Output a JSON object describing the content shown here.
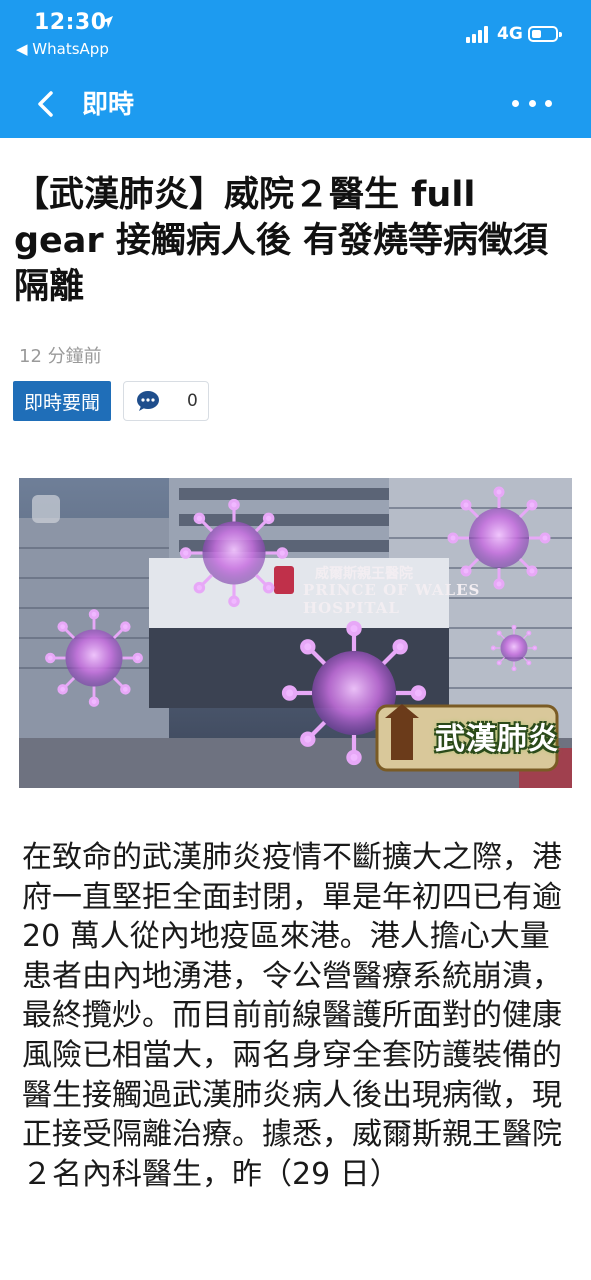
{
  "status_bar": {
    "time": "12:30",
    "back_app": "◀ WhatsApp",
    "network": "4G"
  },
  "nav": {
    "title": "即時",
    "back_icon": "chevron-left-icon",
    "more_icon": "more-dots-icon"
  },
  "article": {
    "headline": "【武漢肺炎】威院２醫生 full gear 接觸病人後 有發燒等病徵須隔離",
    "timestamp": "12 分鐘前",
    "category": "即時要聞",
    "comment_count": "0",
    "image": {
      "sign_en": "PRINCE OF WALES HOSPITAL",
      "sign_cn": "威爾斯親王醫院",
      "badge_label": "武漢肺炎"
    },
    "body": "在致命的武漢肺炎疫情不斷擴大之際，港府一直堅拒全面封閉，單是年初四已有逾 20 萬人從內地疫區來港。港人擔心大量患者由內地湧港，令公營醫療系統崩潰，最終攬炒。而目前前線醫護所面對的健康風險已相當大，兩名身穿全套防護裝備的醫生接觸過武漢肺炎病人後出現病徵，現正接受隔離治療。據悉，威爾斯親王醫院２名內科醫生，昨（29 日）"
  },
  "colors": {
    "header_bg": "#1d9bf0",
    "tag_bg": "#1f6eb8",
    "virus": "#c86ee0"
  }
}
